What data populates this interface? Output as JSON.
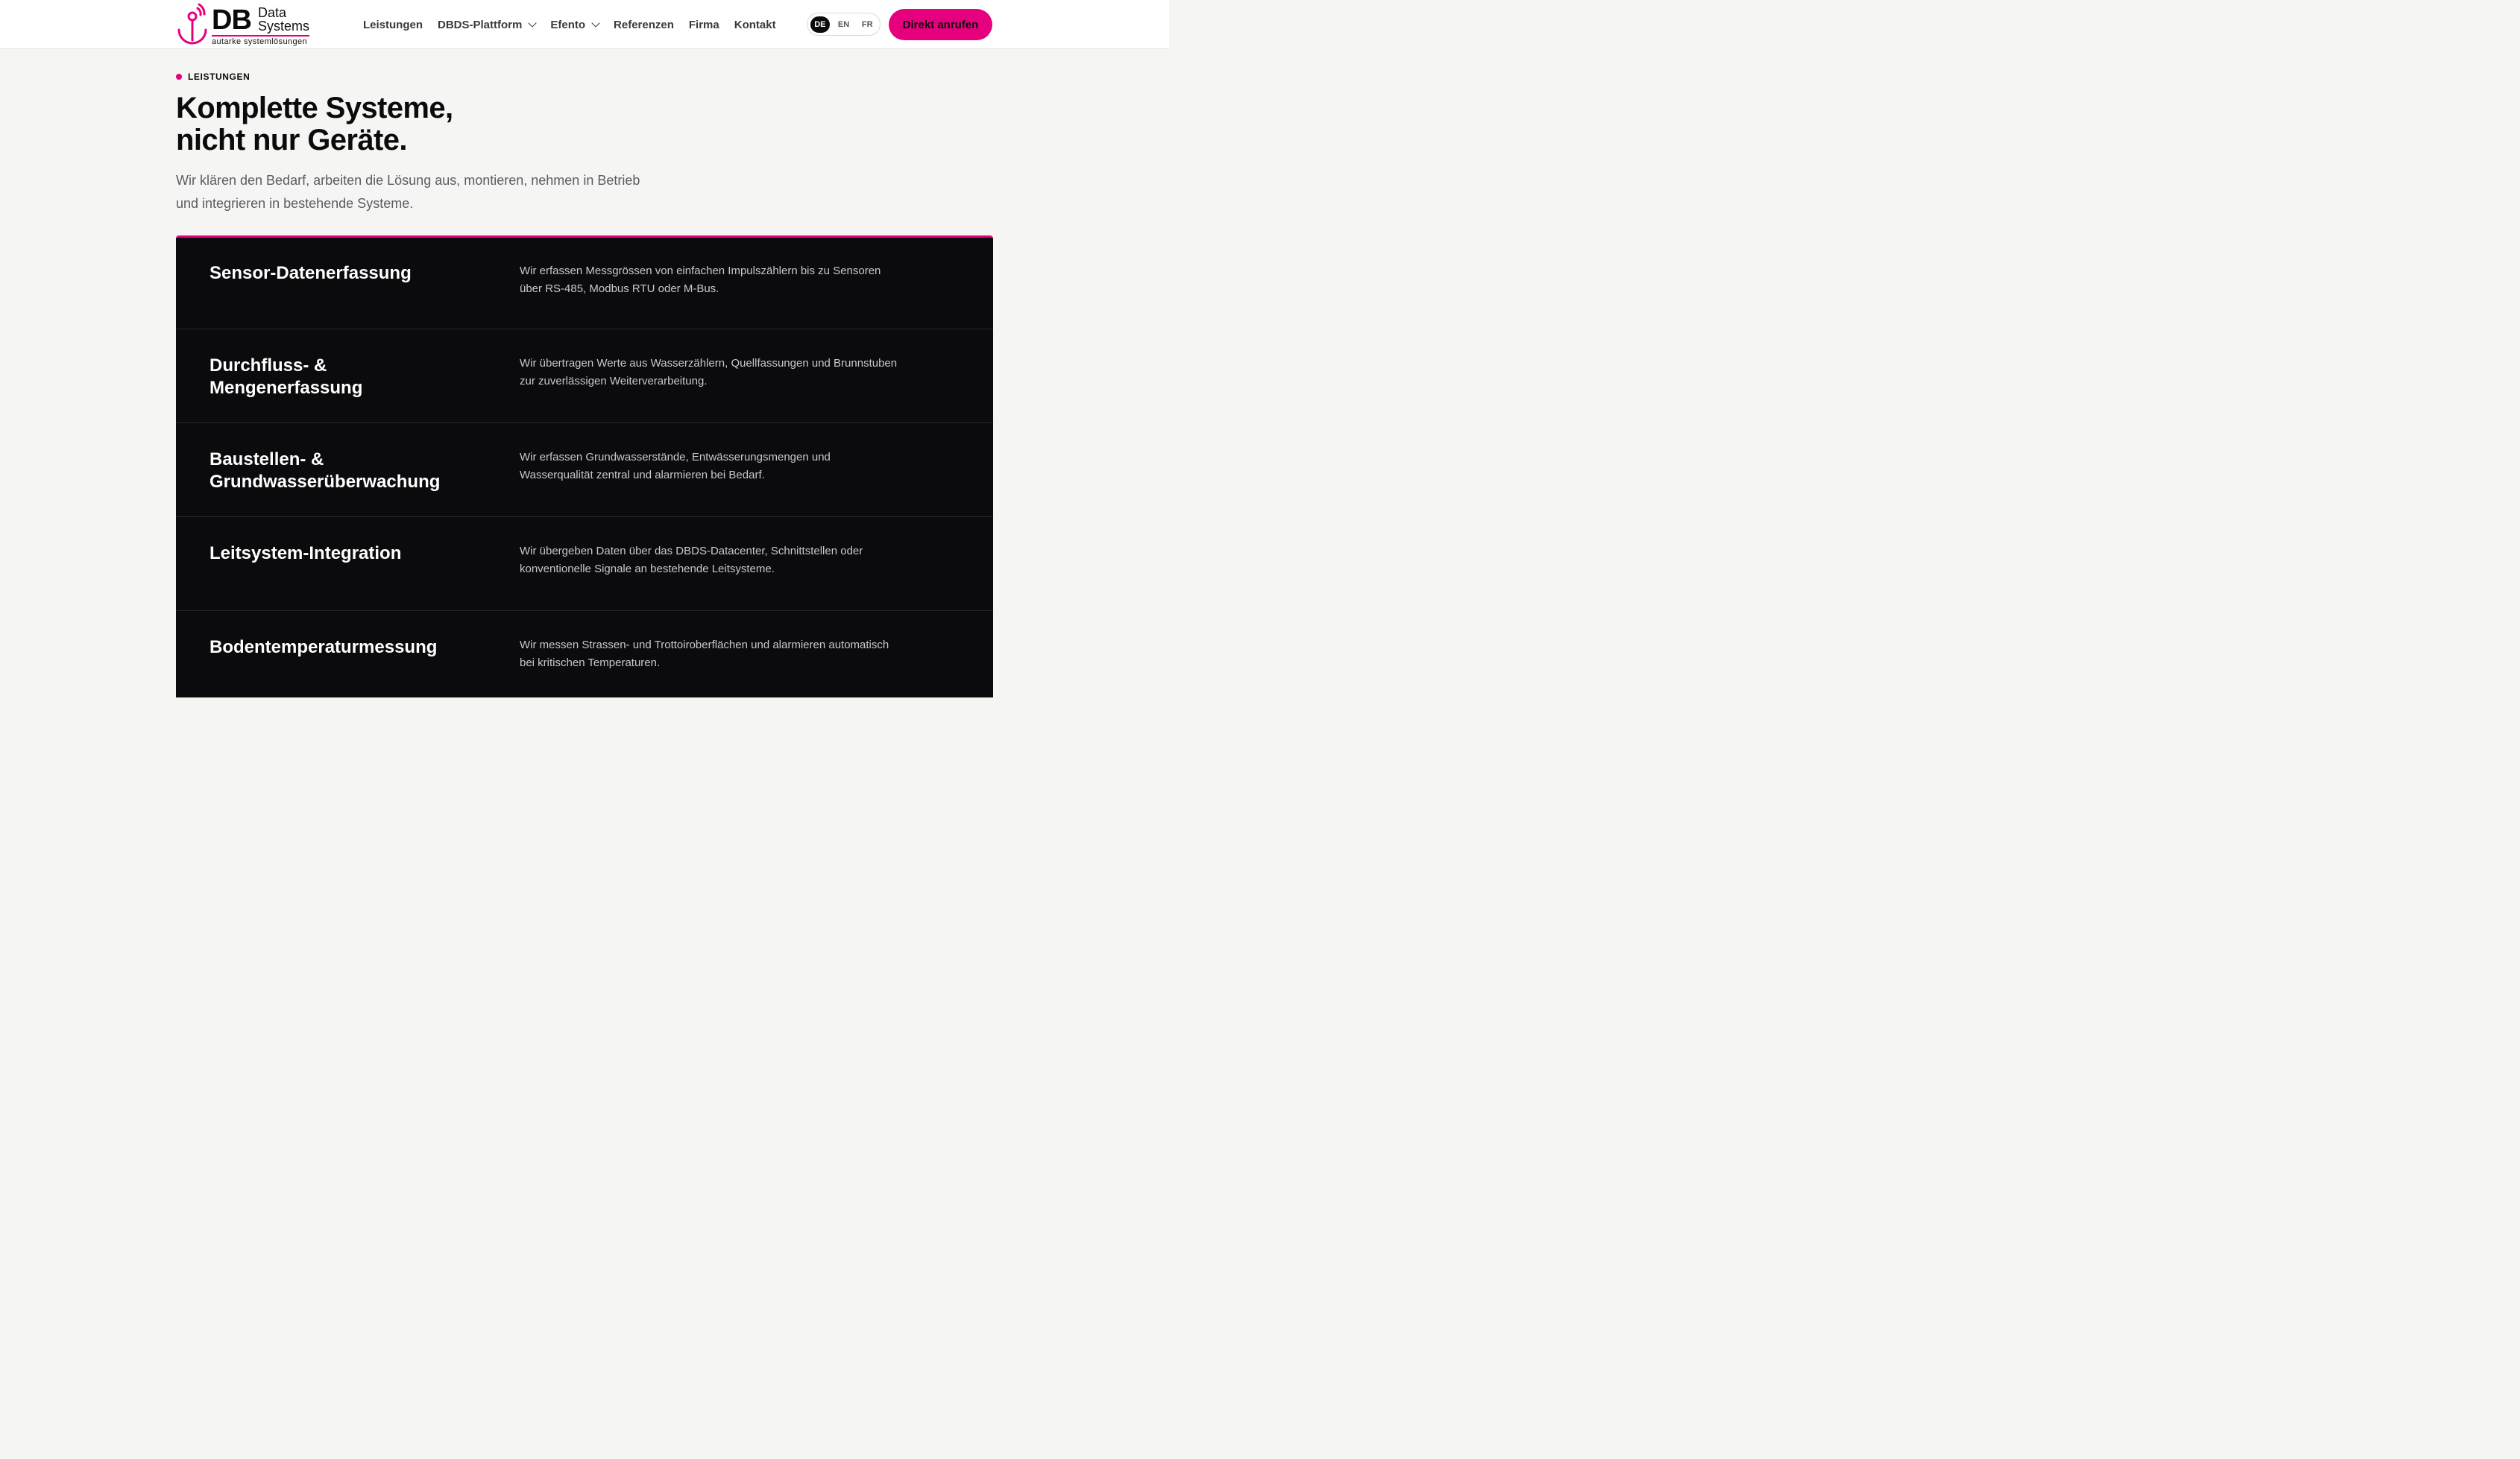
{
  "brand": {
    "logo_main": "DB",
    "logo_line1": "Data",
    "logo_line2": "Systems",
    "logo_tagline": "autarke systemlösungen",
    "accent_color": "#e6007e"
  },
  "nav": {
    "items": [
      {
        "label": "Leistungen",
        "has_dropdown": false
      },
      {
        "label": "DBDS-Plattform",
        "has_dropdown": true
      },
      {
        "label": "Efento",
        "has_dropdown": true
      },
      {
        "label": "Referenzen",
        "has_dropdown": false
      },
      {
        "label": "Firma",
        "has_dropdown": false
      },
      {
        "label": "Kontakt",
        "has_dropdown": false
      }
    ],
    "languages": [
      {
        "code": "DE",
        "active": true
      },
      {
        "code": "EN",
        "active": false
      },
      {
        "code": "FR",
        "active": false
      }
    ],
    "cta_label": "Direkt anrufen"
  },
  "hero": {
    "eyebrow": "LEISTUNGEN",
    "headline_line1": "Komplette Systeme,",
    "headline_line2": "nicht nur Geräte.",
    "lead_line1": "Wir klären den Bedarf, arbeiten die Lösung aus, montieren, nehmen in Betrieb",
    "lead_line2": "und integrieren in bestehende Systeme."
  },
  "services": [
    {
      "title_line1": "Sensor-Datenerfassung",
      "title_line2": "",
      "desc_line1": "Wir erfassen Messgrössen von einfachen Impulszählern bis zu Sensoren",
      "desc_line2": "über RS-485, Modbus RTU oder M-Bus."
    },
    {
      "title_line1": "Durchfluss- &",
      "title_line2": "Mengenerfassung",
      "desc_line1": "Wir übertragen Werte aus Wasserzählern, Quellfassungen und Brunnstuben",
      "desc_line2": "zur zuverlässigen Weiterverarbeitung."
    },
    {
      "title_line1": "Baustellen- &",
      "title_line2": "Grundwasserüberwachung",
      "desc_line1": "Wir erfassen Grundwasserstände, Entwässerungsmengen und",
      "desc_line2": "Wasserqualität zentral und alarmieren bei Bedarf."
    },
    {
      "title_line1": "Leitsystem-Integration",
      "title_line2": "",
      "desc_line1": "Wir übergeben Daten über das DBDS-Datacenter, Schnittstellen oder",
      "desc_line2": "konventionelle Signale an bestehende Leitsysteme."
    },
    {
      "title_line1": "Bodentemperaturmessung",
      "title_line2": "",
      "desc_line1": "Wir messen Strassen- und Trottoiroberflächen und alarmieren automatisch",
      "desc_line2": "bei kritischen Temperaturen."
    }
  ]
}
